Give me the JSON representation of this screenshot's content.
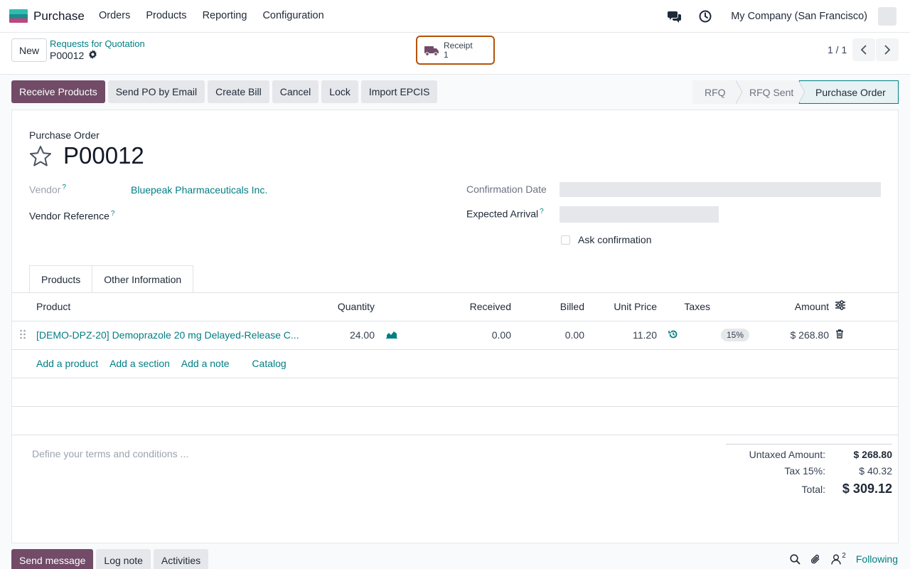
{
  "navbar": {
    "app_name": "Purchase",
    "menu": [
      "Orders",
      "Products",
      "Reporting",
      "Configuration"
    ],
    "company": "My Company (San Francisco)"
  },
  "control": {
    "new_label": "New",
    "breadcrumb_parent": "Requests for Quotation",
    "breadcrumb_current": "P00012",
    "receipt_label": "Receipt",
    "receipt_count": "1",
    "pager": "1 / 1"
  },
  "actions": [
    "Receive Products",
    "Send PO by Email",
    "Create Bill",
    "Cancel",
    "Lock",
    "Import EPCIS"
  ],
  "statusbar": [
    "RFQ",
    "RFQ Sent",
    "Purchase Order"
  ],
  "form": {
    "doc_type": "Purchase Order",
    "doc_name": "P00012",
    "vendor_label": "Vendor",
    "vendor_value": "Bluepeak Pharmaceuticals Inc.",
    "vendor_ref_label": "Vendor Reference",
    "confirmation_date_label": "Confirmation Date",
    "expected_arrival_label": "Expected Arrival",
    "ask_confirmation_label": "Ask confirmation",
    "help_mark": "?"
  },
  "tabs": [
    "Products",
    "Other Information"
  ],
  "lines": {
    "headers": {
      "product": "Product",
      "quantity": "Quantity",
      "received": "Received",
      "billed": "Billed",
      "unit_price": "Unit Price",
      "taxes": "Taxes",
      "amount": "Amount"
    },
    "rows": [
      {
        "product": "[DEMO-DPZ-20] Demoprazole 20 mg Delayed-Release C...",
        "quantity": "24.00",
        "received": "0.00",
        "billed": "0.00",
        "unit_price": "11.20",
        "tax": "15%",
        "amount": "$ 268.80"
      }
    ],
    "add_links": [
      "Add a product",
      "Add a section",
      "Add a note",
      "Catalog"
    ]
  },
  "terms_placeholder": "Define your terms and conditions ...",
  "totals": {
    "untaxed_label": "Untaxed Amount:",
    "untaxed_value": "$ 268.80",
    "tax_label": "Tax 15%:",
    "tax_value": "$ 40.32",
    "total_label": "Total:",
    "total_value": "$ 309.12"
  },
  "chatter": {
    "buttons": [
      "Send message",
      "Log note",
      "Activities"
    ],
    "followers_count": "2",
    "following_label": "Following"
  },
  "colors": {
    "brand": "#714b67",
    "link": "#017e84",
    "highlight_border": "#b45309"
  }
}
